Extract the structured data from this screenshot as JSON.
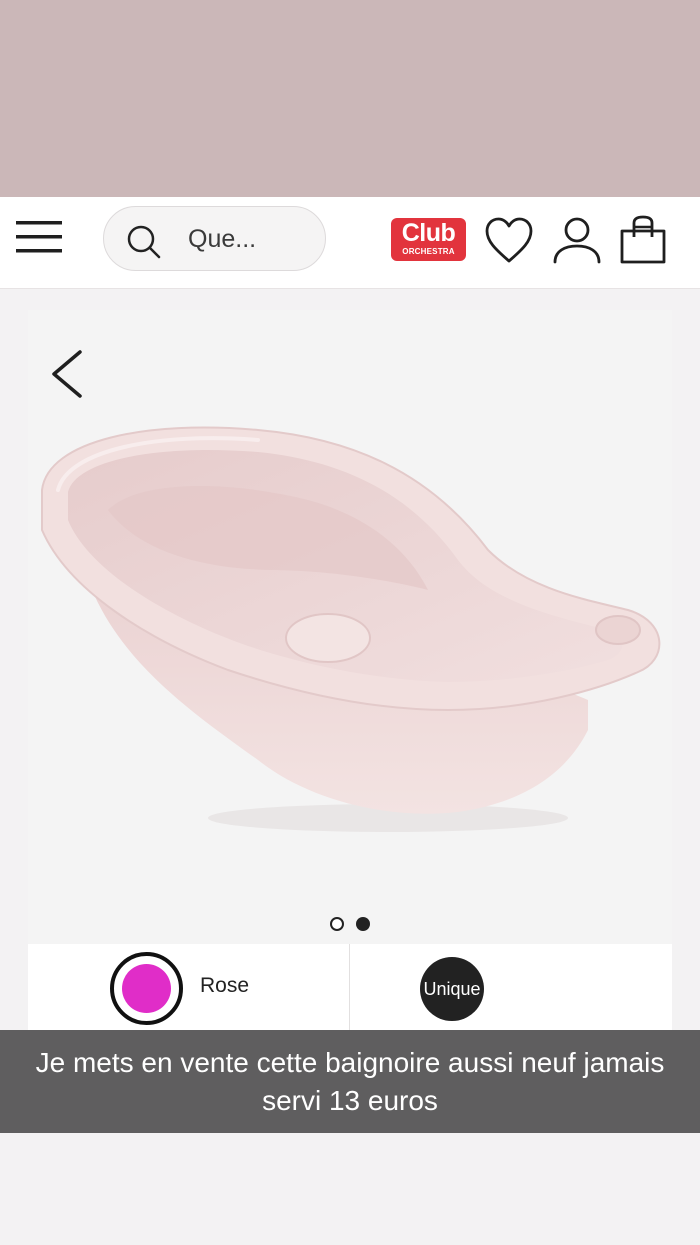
{
  "header": {
    "search_placeholder": "Que...",
    "logo_text": "Club",
    "logo_subtext": "ORCHESTRA"
  },
  "gallery": {
    "slide_count": 2,
    "active_slide": 2
  },
  "options": {
    "color_label": "Rose",
    "color_hex": "#e02dc8",
    "size_label": "Unique"
  },
  "caption": {
    "text": "Je mets en vente cette baignoire aussi neuf jamais servi 13 euros"
  },
  "colors": {
    "top_band": "#cbb7b8",
    "logo_red": "#e2343d",
    "caption_bg": "#5f5e5f",
    "tub_pink": "#f0dada"
  }
}
